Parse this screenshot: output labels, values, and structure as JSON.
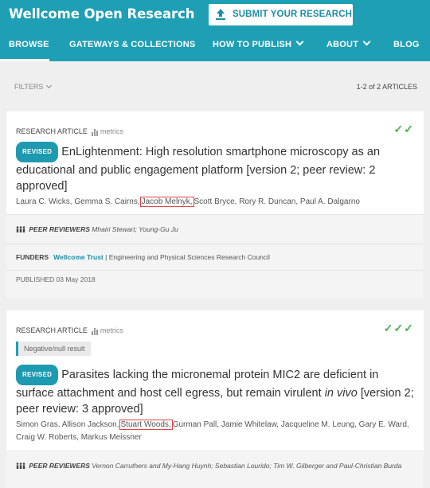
{
  "header": {
    "brand": "Wellcome Open Research",
    "submit_label": "SUBMIT YOUR RESEARCH",
    "nav": [
      {
        "label": "BROWSE",
        "active": true
      },
      {
        "label": "GATEWAYS & COLLECTIONS"
      },
      {
        "label": "HOW TO PUBLISH"
      },
      {
        "label": "ABOUT"
      },
      {
        "label": "BLOG"
      }
    ]
  },
  "toolbar": {
    "filters_label": "FILTERS",
    "count": "1-2 of 2 ARTICLES"
  },
  "articles": [
    {
      "type": "RESEARCH ARTICLE",
      "metrics": "metrics",
      "checks": "✓✓",
      "badge": "REVISED",
      "title": "EnLightenment: High resolution smartphone microscopy as an educational and public engagement platform [version 2; peer review: 2 approved]",
      "authors_before": "Laura C. Wicks, Gemma S. Cairns,",
      "authors_highlight": "Jacob Melnyk,",
      "authors_after": "Scott Bryce, Rory R. Duncan, Paul A. Dalgarno",
      "reviewers_label": "PEER REVIEWERS",
      "reviewers": "Mhairi Stewart; Young-Gu Ju",
      "funders_label": "FUNDERS",
      "funder_primary": "Wellcome Trust",
      "funder_rest": "| Engineering and Physical Sciences Research Council",
      "published": "PUBLISHED 03 May 2018"
    },
    {
      "type": "RESEARCH ARTICLE",
      "metrics": "metrics",
      "checks": "✓✓✓",
      "tag": "Negative/null result",
      "badge": "REVISED",
      "title_pre": "Parasites lacking the micronemal protein MIC2 are deficient in surface attachment and host cell egress, but remain virulent",
      "title_em": "in vivo",
      "title_post": "[version 2; peer review: 3 approved]",
      "authors_before": "Simon Gras, Allison Jackson,",
      "authors_highlight": "Stuart Woods,",
      "authors_after": "Gurman Pall, Jamie Whitelaw, Jacqueline M. Leung, Gary E. Ward, Craig W. Roberts, Markus Meissner",
      "reviewers_label": "PEER REVIEWERS",
      "reviewers": "Vernon Carruthers and My-Hang Huynh; Sebastian Lourido; Tim W. Gilberger and Paul-Christian Burda"
    }
  ],
  "colors": {
    "brand": "#1f9fb4",
    "approved": "#4caf50",
    "highlight_border": "#dd4444"
  }
}
